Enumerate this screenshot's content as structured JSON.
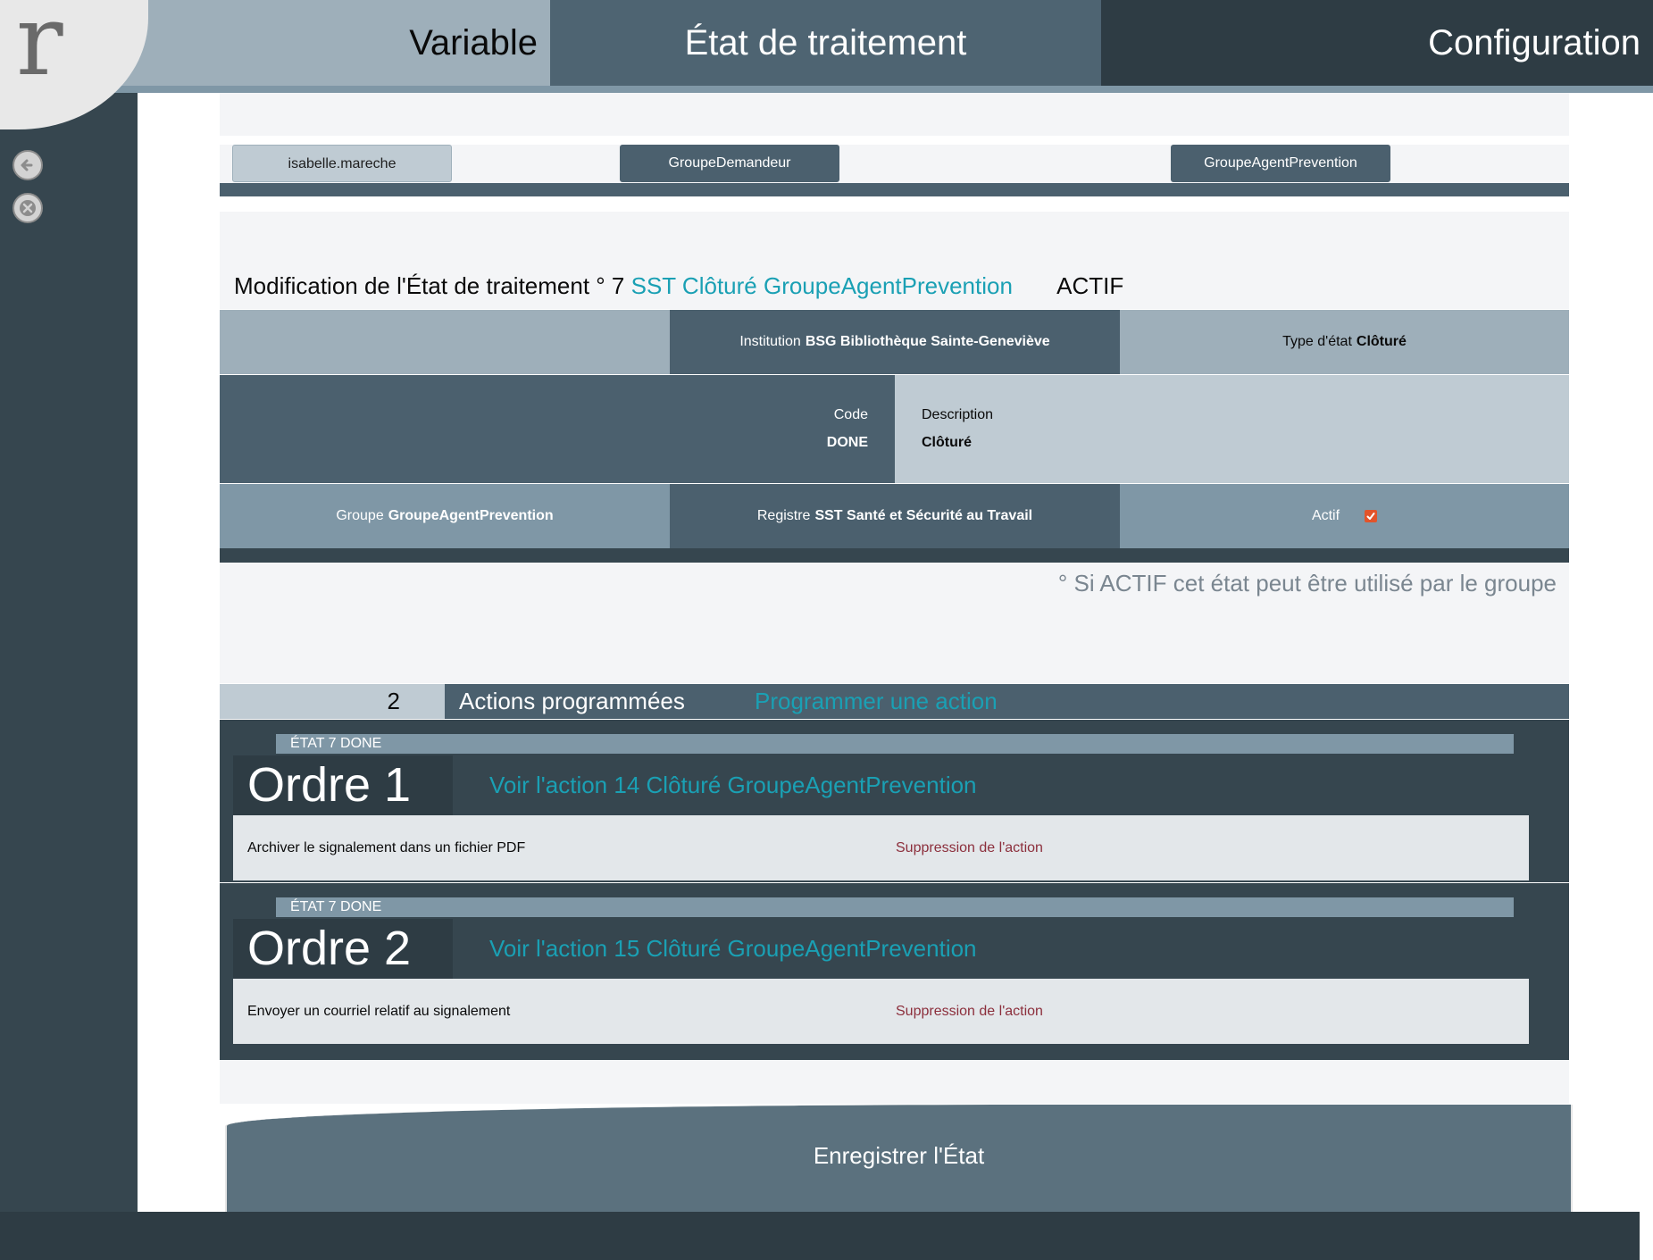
{
  "topbar": {
    "logo_glyph": "r",
    "tabs": [
      "Variable",
      "État de traitement",
      "Configuration"
    ]
  },
  "sidebar": {
    "back_icon": "arrow-left-icon",
    "close_icon": "close-icon"
  },
  "users": {
    "current_user": "isabelle.mareche",
    "group_requester": "GroupeDemandeur",
    "group_agent": "GroupeAgentPrevention"
  },
  "heading": {
    "prefix": "Modification de l'État de traitement ° 7",
    "link": "SST Clôturé GroupeAgentPrevention",
    "status": "ACTIF"
  },
  "details": {
    "institution_label": "Institution",
    "institution_value": "BSG Bibliothèque Sainte-Geneviève",
    "type_label": "Type d'état",
    "type_value": "Clôturé",
    "code_label": "Code",
    "code_value": "DONE",
    "description_label": "Description",
    "description_value": "Clôturé",
    "group_label": "Groupe",
    "group_value": "GroupeAgentPrevention",
    "registry_label": "Registre",
    "registry_value": "SST Santé et Sécurité au Travail",
    "active_label": "Actif",
    "active_checked": true
  },
  "note": "° Si ACTIF cet état peut être utilisé par le groupe",
  "actions": {
    "count": "2",
    "title": "Actions programmées",
    "add_link": "Programmer une action",
    "items": [
      {
        "etat": "ÉTAT 7 DONE",
        "ordre": "Ordre 1",
        "link": "Voir l'action 14 Clôturé GroupeAgentPrevention",
        "description": "Archiver le signalement dans un fichier PDF",
        "delete": "Suppression de l'action"
      },
      {
        "etat": "ÉTAT 7 DONE",
        "ordre": "Ordre 2",
        "link": "Voir l'action 15 Clôturé GroupeAgentPrevention",
        "description": "Envoyer un courriel relatif au signalement",
        "delete": "Suppression de l'action"
      }
    ]
  },
  "save_button": "Enregistrer l'État",
  "colors": {
    "accent_link": "#1aa0b4",
    "delete_link": "#8c2f3c",
    "checkbox": "#e2542b",
    "dark": "#36464f",
    "mid": "#4b606e",
    "light": "#bfcbd3"
  }
}
